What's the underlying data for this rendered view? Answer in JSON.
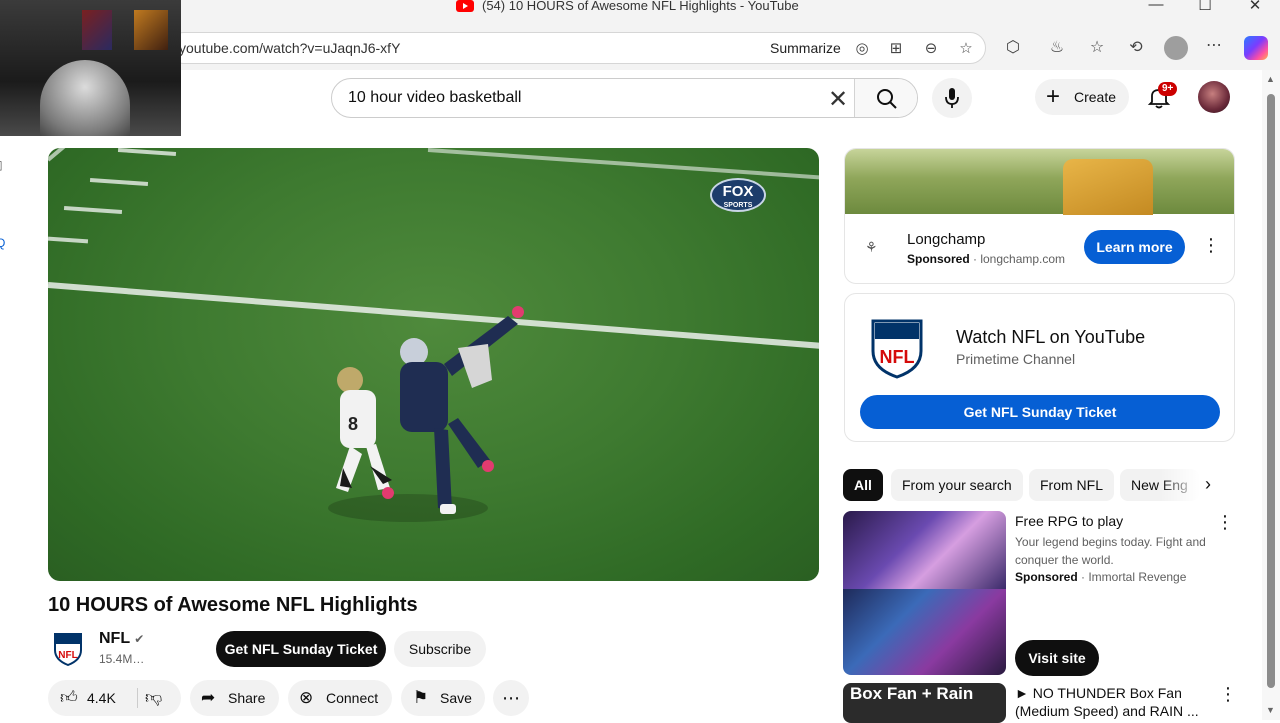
{
  "browser": {
    "title": "(54) 10 HOURS of Awesome NFL Highlights - YouTube",
    "url": "youtube.com/watch?v=uJaqnJ6-xfY",
    "summarize_label": "Summarize"
  },
  "masthead": {
    "search_query": "10 hour video basketball",
    "create_label": "Create",
    "notification_count": "9+"
  },
  "video": {
    "title": "10 HOURS of Awesome NFL Highlights",
    "overlay_logo": "FOX",
    "overlay_logo_sub": "SPORTS",
    "channel_name": "NFL",
    "subscribers": "15.4M…",
    "ticket_button": "Get NFL Sunday Ticket",
    "subscribe_button": "Subscribe",
    "likes": "4.4K",
    "share_label": "Share",
    "connect_label": "Connect",
    "save_label": "Save"
  },
  "ad": {
    "brand": "Longchamp",
    "sponsored": "Sponsored",
    "domain": "longchamp.com",
    "cta": "Learn more"
  },
  "nfl_promo": {
    "title": "Watch NFL on YouTube",
    "subtitle": "Primetime Channel",
    "cta": "Get NFL Sunday Ticket",
    "shield_text": "NFL"
  },
  "chips": [
    "All",
    "From your search",
    "From NFL",
    "New Eng"
  ],
  "recommendations": [
    {
      "title": "Free RPG to play",
      "description": "Your legend begins today. Fight and conquer the world.",
      "sponsored": "Sponsored",
      "advertiser": "Immortal Revenge",
      "cta": "Visit site"
    },
    {
      "title": "► NO THUNDER Box Fan (Medium Speed) and RAIN ...",
      "thumb_text": "Box Fan + Rain"
    }
  ],
  "colors": {
    "accent_blue": "#065fd4",
    "yt_red": "#ff0000",
    "notification_red": "#cc0000",
    "field_green": "#3e7a30"
  }
}
